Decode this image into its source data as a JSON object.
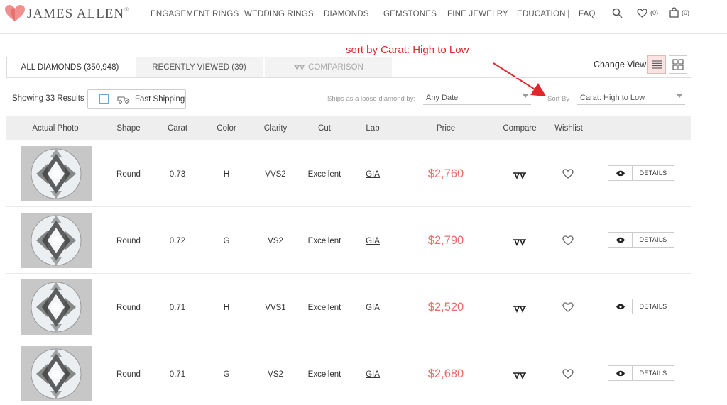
{
  "header": {
    "logo_text": "JAMES ALLEN",
    "logo_mark": "®",
    "nav": [
      "ENGAGEMENT RINGS",
      "WEDDING RINGS",
      "DIAMONDS",
      "GEMSTONES",
      "FINE JEWELRY",
      "EDUCATION",
      "FAQ"
    ],
    "separator": "|",
    "wishlist_count": "(0)",
    "cart_count": "(0)",
    "icons": [
      "search-icon",
      "heart-icon",
      "bag-icon"
    ]
  },
  "annotation": {
    "text": "sort by Carat: High to Low",
    "color": "#e0262b"
  },
  "tabs": [
    {
      "label": "ALL DIAMONDS (350,948)",
      "active": true
    },
    {
      "label": "RECENTLY VIEWED (39)",
      "active": false
    },
    {
      "label": "COMPARISON",
      "active": false
    }
  ],
  "view": {
    "label": "Change View",
    "selected": "list"
  },
  "filters": {
    "showing": "Showing 33 Results",
    "fast_shipping": "Fast Shipping",
    "fast_shipping_checked": false,
    "ships_label": "Ships as a loose diamond by:",
    "ships_value": "Any Date",
    "sort_label": "Sort By",
    "sort_value": "Carat: High to Low"
  },
  "table": {
    "columns": [
      "Actual Photo",
      "Shape",
      "Carat",
      "Color",
      "Clarity",
      "Cut",
      "Lab",
      "Price",
      "Compare",
      "Wishlist"
    ],
    "details_label": "DETAILS",
    "rows": [
      {
        "shape": "Round",
        "carat": "0.73",
        "color": "H",
        "clarity": "VVS2",
        "cut": "Excellent",
        "lab": "GIA",
        "price": "$2,760"
      },
      {
        "shape": "Round",
        "carat": "0.72",
        "color": "G",
        "clarity": "VS2",
        "cut": "Excellent",
        "lab": "GIA",
        "price": "$2,790"
      },
      {
        "shape": "Round",
        "carat": "0.71",
        "color": "H",
        "clarity": "VVS1",
        "cut": "Excellent",
        "lab": "GIA",
        "price": "$2,520"
      },
      {
        "shape": "Round",
        "carat": "0.71",
        "color": "G",
        "clarity": "VS2",
        "cut": "Excellent",
        "lab": "GIA",
        "price": "$2,680"
      }
    ]
  },
  "colors": {
    "brand": "#e86d6d",
    "price": "#e86d6d",
    "header_bg": "#eeeeee"
  }
}
